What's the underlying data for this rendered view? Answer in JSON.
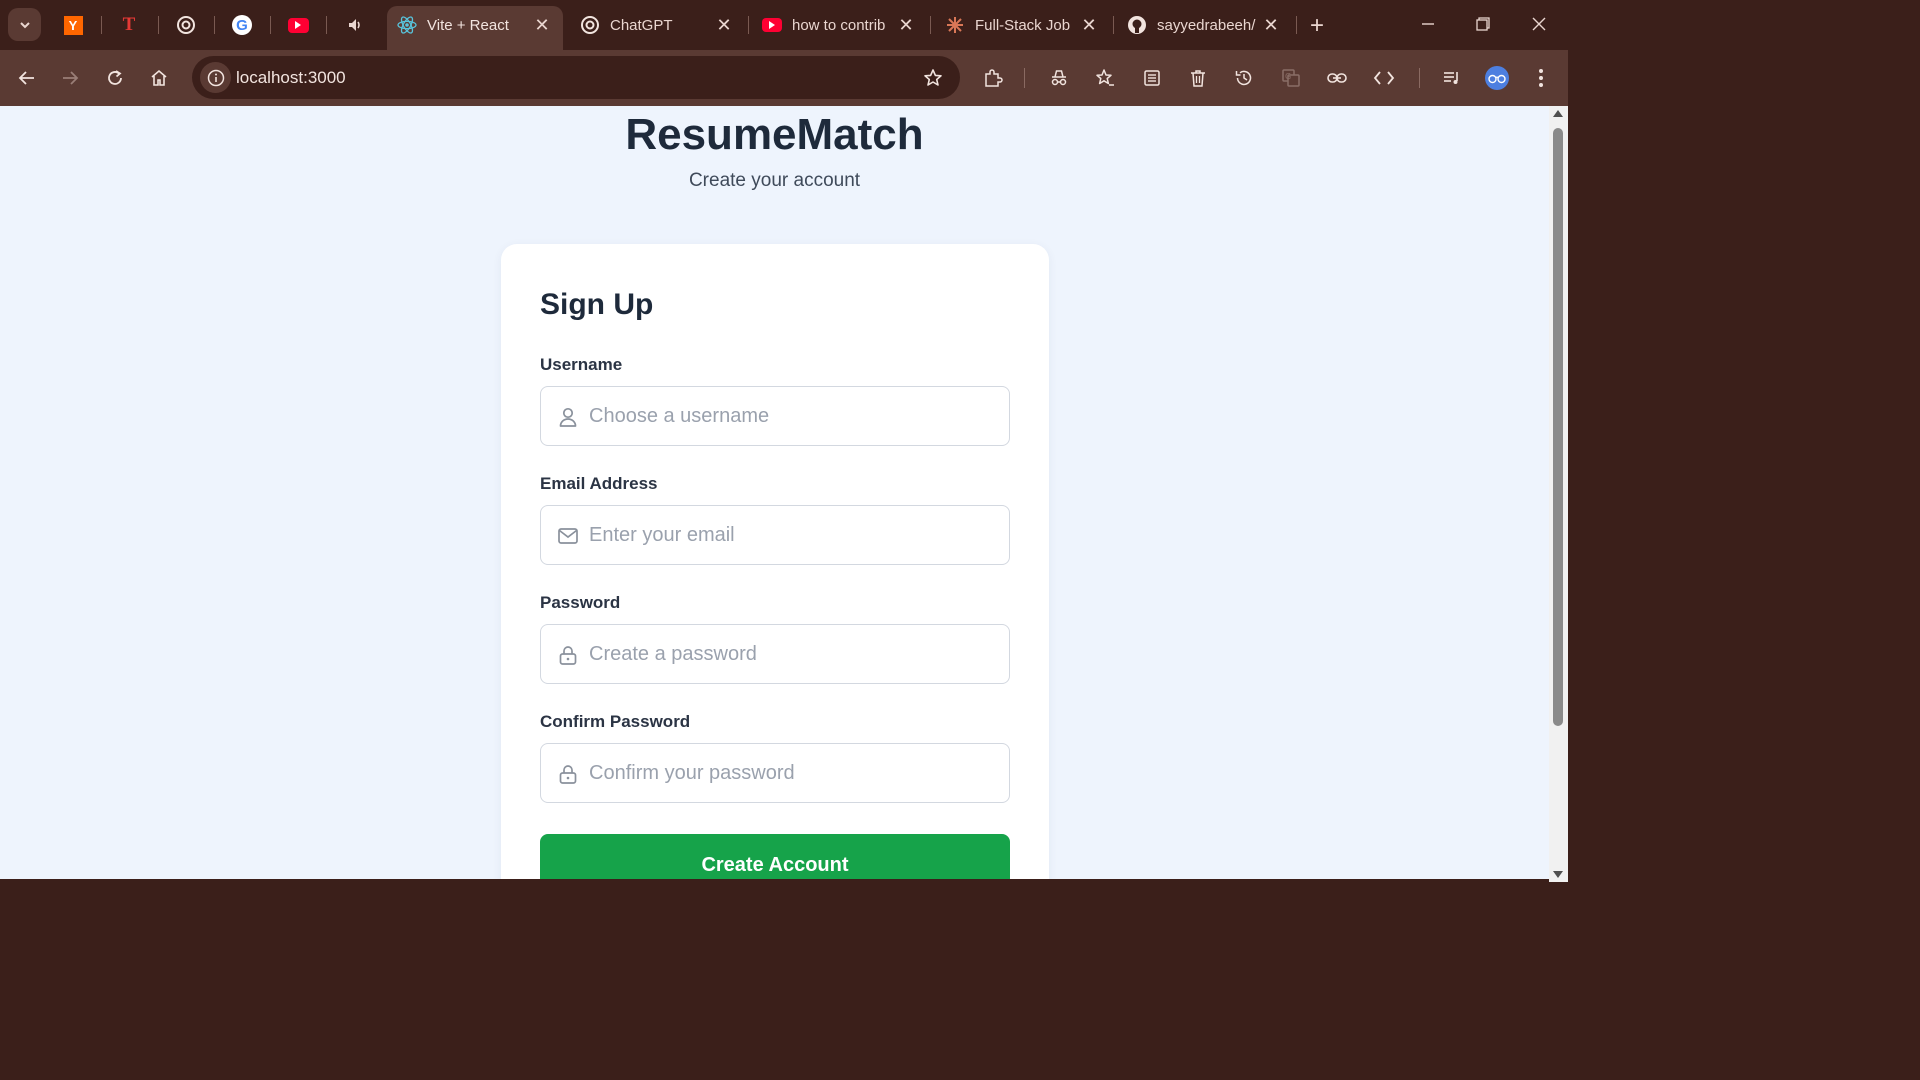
{
  "tabs": {
    "pinned": [
      {
        "name": "Y"
      },
      {
        "name": "T"
      }
    ],
    "items": [
      {
        "title": "Vite + React",
        "active": true
      },
      {
        "title": "ChatGPT",
        "active": false
      },
      {
        "title": "how to contrib",
        "active": false
      },
      {
        "title": "Full-Stack Job",
        "active": false
      },
      {
        "title": "sayyedrabeeh/",
        "active": false
      }
    ]
  },
  "toolbar": {
    "url": "localhost:3000"
  },
  "page": {
    "brand": "ResumeMatch",
    "tagline": "Create your account",
    "form": {
      "title": "Sign Up",
      "username_label": "Username",
      "username_placeholder": "Choose a username",
      "email_label": "Email Address",
      "email_placeholder": "Enter your email",
      "password_label": "Password",
      "password_placeholder": "Create a password",
      "confirm_label": "Confirm Password",
      "confirm_placeholder": "Confirm your password",
      "submit_label": "Create Account"
    }
  },
  "colors": {
    "accent": "#16a34a",
    "page_bg": "#eef4fd",
    "browser_frame": "#3b1f1a"
  }
}
